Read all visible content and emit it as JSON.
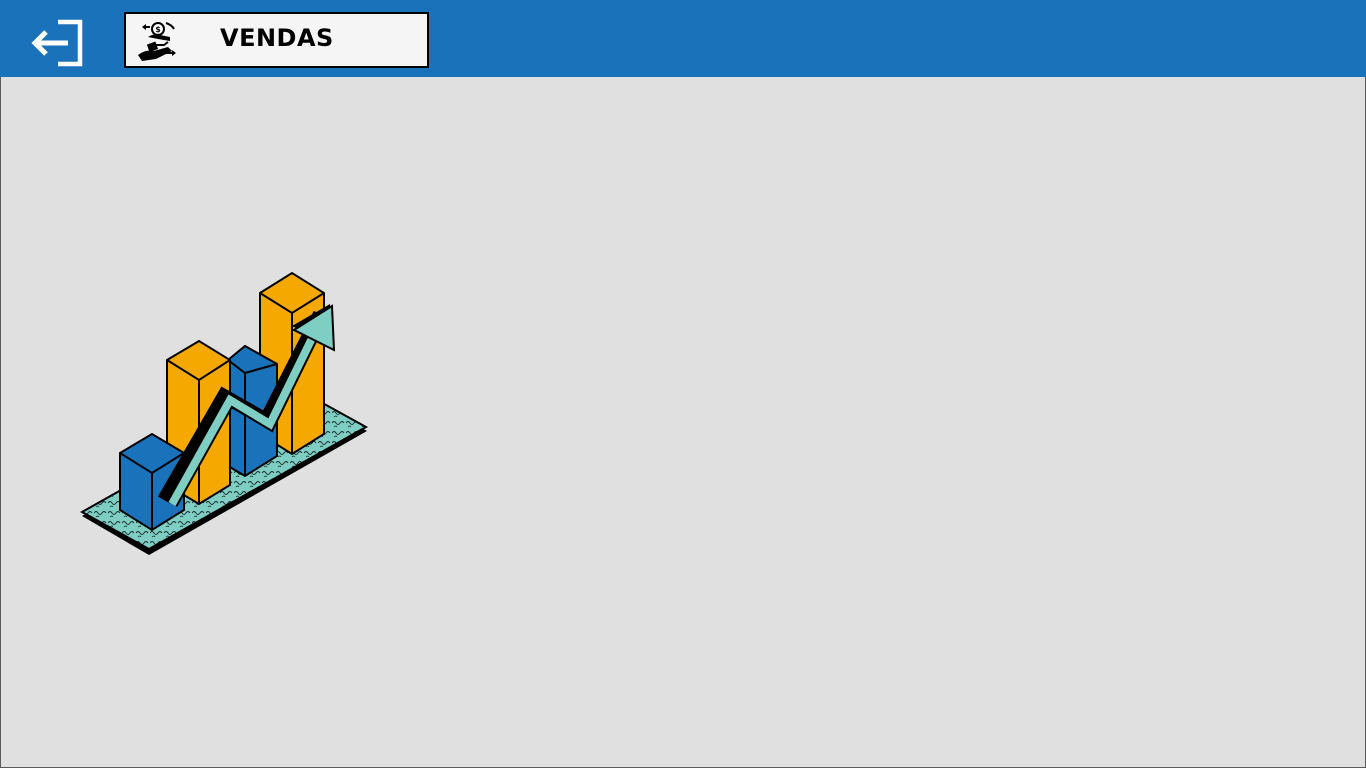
{
  "header": {
    "title": "VENDAS",
    "exit_icon": "logout-arrow-icon",
    "title_icon": "money-exchange-hands-icon"
  },
  "main": {
    "illustration": "growth-bar-chart-illustration"
  },
  "colors": {
    "topbar": "#1a72bb",
    "background": "#e0e0e0",
    "bar_blue": "#1a72bb",
    "bar_orange": "#f5a800",
    "arrow_teal": "#7ecec4"
  }
}
